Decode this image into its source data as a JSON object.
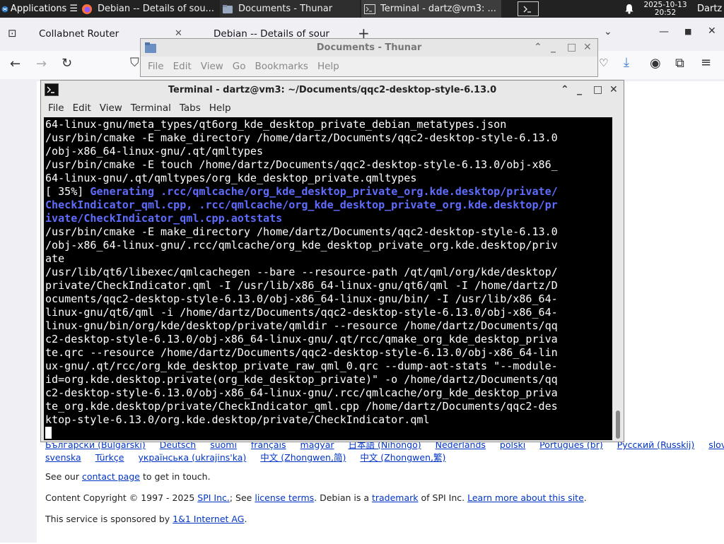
{
  "panel": {
    "apps_label": "Applications",
    "apps_suffix": "☰",
    "tasks": [
      {
        "label": "Debian -- Details of sou..."
      },
      {
        "label": "Documents - Thunar"
      },
      {
        "label": "Terminal - dartz@vm3: ..."
      }
    ],
    "clock_date": "2025-10-13",
    "clock_time": "20:52",
    "user": "Dartz"
  },
  "firefox": {
    "tab1": "Collabnet Router",
    "tab2": "Debian -- Details of sour",
    "footer": {
      "languages_row1": [
        "Български (Bulgarski)",
        "Deutsch",
        "suomi",
        "français",
        "magyar",
        "日本語 (Nihongo)",
        "Nederlands",
        "polski",
        "Português (br)",
        "Русский (Russkij)",
        "slovensky"
      ],
      "languages_row2": [
        "svenska",
        "Türkçe",
        "українська (ukrajins'ka)",
        "中文 (Zhongwen,简)",
        "中文 (Zhongwen,繁)"
      ],
      "contact_prefix": "See our ",
      "contact_link": "contact page",
      "contact_suffix": " to get in touch.",
      "copyright_prefix": "Content Copyright © 1997 - 2025 ",
      "spi_link": "SPI Inc.",
      "see": "; See ",
      "license_link": "license terms",
      "debian_is": ". Debian is a ",
      "trademark_link": "trademark",
      "of_spi": " of SPI Inc. ",
      "learn_link": "Learn more about this site",
      "period": ".",
      "sponsor_prefix": "This service is sponsored by ",
      "sponsor_link": "1&1 Internet AG",
      "sponsor_suffix": "."
    }
  },
  "thunar": {
    "title": "Documents - Thunar",
    "menu": [
      "File",
      "Edit",
      "View",
      "Go",
      "Bookmarks",
      "Help"
    ]
  },
  "terminal": {
    "title": "Terminal - dartz@vm3: ~/Documents/qqc2-desktop-style-6.13.0",
    "menu": [
      "File",
      "Edit",
      "View",
      "Terminal",
      "Tabs",
      "Help"
    ],
    "lines": [
      "64-linux-gnu/meta_types/qt6org_kde_desktop_private_debian_metatypes.json",
      "/usr/bin/cmake -E make_directory /home/dartz/Documents/qqc2-desktop-style-6.13.0",
      "/obj-x86_64-linux-gnu/.qt/qmltypes",
      "/usr/bin/cmake -E touch /home/dartz/Documents/qqc2-desktop-style-6.13.0/obj-x86_",
      "64-linux-gnu/.qt/qmltypes/org_kde_desktop_private.qmltypes"
    ],
    "progress": "[ 35%] ",
    "gen_lines": [
      "Generating .rcc/qmlcache/org_kde_desktop_private_org.kde.desktop/private/",
      "CheckIndicator_qml.cpp, .rcc/qmlcache/org_kde_desktop_private_org.kde.desktop/pr",
      "ivate/CheckIndicator_qml.cpp.aotstats"
    ],
    "lines2": [
      "/usr/bin/cmake -E make_directory /home/dartz/Documents/qqc2-desktop-style-6.13.0",
      "/obj-x86_64-linux-gnu/.rcc/qmlcache/org_kde_desktop_private_org.kde.desktop/priv",
      "ate",
      "/usr/lib/qt6/libexec/qmlcachegen --bare --resource-path /qt/qml/org/kde/desktop/",
      "private/CheckIndicator.qml -I /usr/lib/x86_64-linux-gnu/qt6/qml -I /home/dartz/D",
      "ocuments/qqc2-desktop-style-6.13.0/obj-x86_64-linux-gnu/bin/ -I /usr/lib/x86_64-",
      "linux-gnu/qt6/qml -i /home/dartz/Documents/qqc2-desktop-style-6.13.0/obj-x86_64-",
      "linux-gnu/bin/org/kde/desktop/private/qmldir --resource /home/dartz/Documents/qq",
      "c2-desktop-style-6.13.0/obj-x86_64-linux-gnu/.qt/rcc/qmake_org_kde_desktop_priva",
      "te.qrc --resource /home/dartz/Documents/qqc2-desktop-style-6.13.0/obj-x86_64-lin",
      "ux-gnu/.qt/rcc/org_kde_desktop_private_raw_qml_0.qrc --dump-aot-stats \"--module-",
      "id=org.kde.desktop.private(org_kde_desktop_private)\" -o /home/dartz/Documents/qq",
      "c2-desktop-style-6.13.0/obj-x86_64-linux-gnu/.rcc/qmlcache/org_kde_desktop_priva",
      "te_org.kde.desktop/private/CheckIndicator_qml.cpp /home/dartz/Documents/qqc2-des",
      "ktop-style-6.13.0/org.kde.desktop/private/CheckIndicator.qml"
    ]
  },
  "colors": {
    "panel_bg": "#222222",
    "terminal_bg": "#000000",
    "terminal_fg": "#ffffff",
    "generating": "#5f6dff",
    "link": "#0035c7"
  }
}
